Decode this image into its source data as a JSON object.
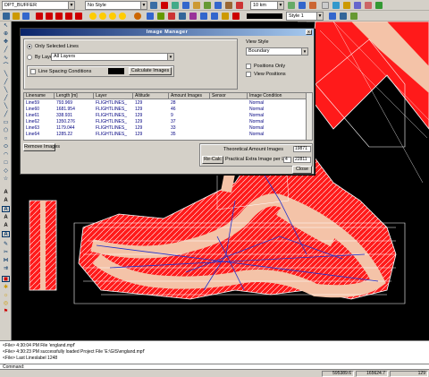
{
  "toolbar": {
    "layer_combo": "DPT_BUFFER",
    "style_combo": "No Style",
    "scale_combo": "10 km",
    "line_style_combo": "Style 1"
  },
  "dialog": {
    "title": "Image Manager",
    "close_x": "x",
    "opt_selected": "Only Selected Lines",
    "opt_by_layer": "By Layer",
    "layer_value": "All Layers",
    "line_spacing": "Line Spacing Conditions",
    "calc_images": "Calculate Images",
    "view_style_label": "View Style",
    "view_style_value": "Boundary",
    "positions_only": "Positions Only",
    "view_positions": "View Positions",
    "remove_images": "Remove Images",
    "theoretical_label": "Theoretical Amount Images",
    "theoretical_value": "19871",
    "recalc": "Re-Calc",
    "practical_label": "Practical Extra Image per Line",
    "practical_per_line": "4",
    "practical_value": "22811",
    "close": "Close"
  },
  "table": {
    "headers": [
      "Linename",
      "Length [m]",
      "Layer",
      "Altitude",
      "Amount Images",
      "Sensor",
      "Image Condition"
    ],
    "rows": [
      [
        "Line59",
        "793.969",
        "FLIGHTLINES_",
        "129",
        "28",
        "",
        "Normal"
      ],
      [
        "Line60",
        "1681.954",
        "FLIGHTLINES_",
        "129",
        "46",
        "",
        "Normal"
      ],
      [
        "Line61",
        "338.931",
        "FLIGHTLINES_",
        "129",
        "9",
        "",
        "Normal"
      ],
      [
        "Line62",
        "1350.276",
        "FLIGHTLINES_",
        "129",
        "37",
        "",
        "Normal"
      ],
      [
        "Line63",
        "1179.044",
        "FLIGHTLINES_",
        "129",
        "33",
        "",
        "Normal"
      ],
      [
        "Line64",
        "1285.22",
        "FLIGHTLINES_",
        "129",
        "35",
        "",
        "Normal"
      ]
    ]
  },
  "log": {
    "line1": "<File> 4:30:04 PM File 'england.mpf'",
    "line2": "<File> 4:30:23 PM successfully loaded Project File 'E:\\GIS\\england.mpf'",
    "line3": "<File> Last Lineslabel 1248",
    "command": "Command:"
  },
  "status": {
    "coord_x": "595389.6",
    "coord_y": "165624.7",
    "scale": "129"
  }
}
